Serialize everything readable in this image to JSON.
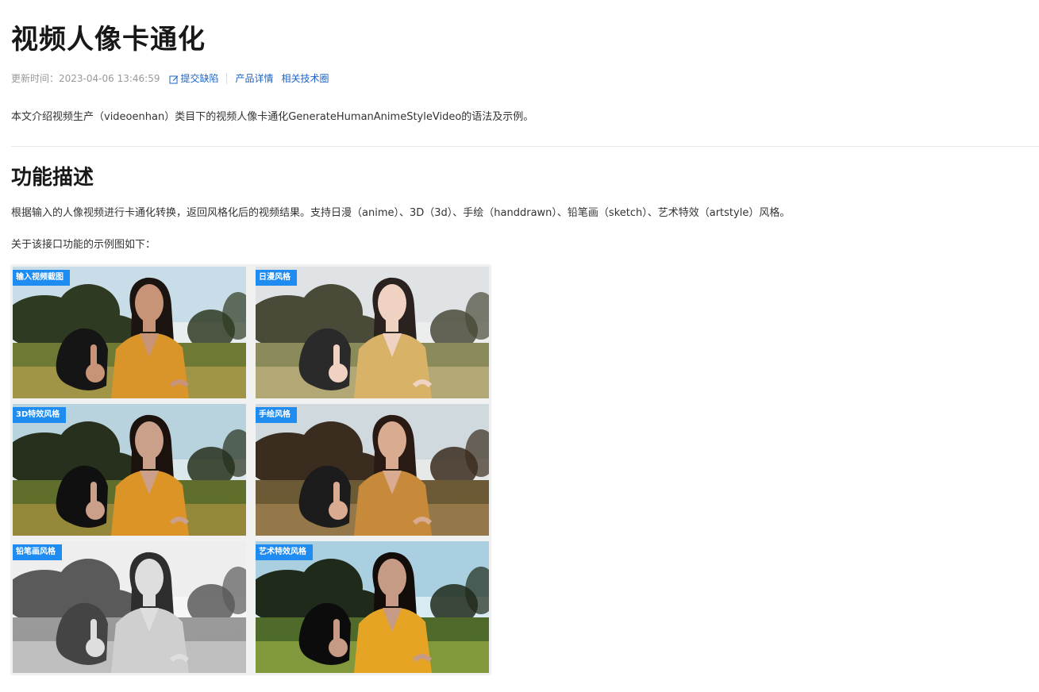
{
  "page": {
    "title": "视频人像卡通化"
  },
  "meta": {
    "updated_label": "更新时间：",
    "updated_time": "2023-04-06 13:46:59",
    "feedback_link": "提交缺陷",
    "product_link": "产品详情",
    "community_link": "相关技术圈"
  },
  "intro": "本文介绍视频生产（videoenhan）类目下的视频人像卡通化GenerateHumanAnimeStyleVideo的语法及示例。",
  "section": {
    "title": "功能描述",
    "description": "根据输入的人像视频进行卡通化转换，返回风格化后的视频结果。支持日漫（anime）、3D（3d）、手绘（handdrawn）、铅笔画（sketch）、艺术特效（artstyle）风格。",
    "example_caption": "关于该接口功能的示例图如下："
  },
  "figure": {
    "tiles": [
      {
        "label": "输入视频截图",
        "style": "original"
      },
      {
        "label": "日漫风格",
        "style": "anime"
      },
      {
        "label": "3D特效风格",
        "style": "3d"
      },
      {
        "label": "手绘风格",
        "style": "handdrawn"
      },
      {
        "label": "铅笔画风格",
        "style": "sketch"
      },
      {
        "label": "艺术特效风格",
        "style": "artstyle"
      }
    ]
  },
  "colors": {
    "link": "#1f63c6",
    "tag_background": "#1e8cf0",
    "meta_text": "#999999"
  },
  "icons": {
    "feedback": "edit-icon"
  }
}
